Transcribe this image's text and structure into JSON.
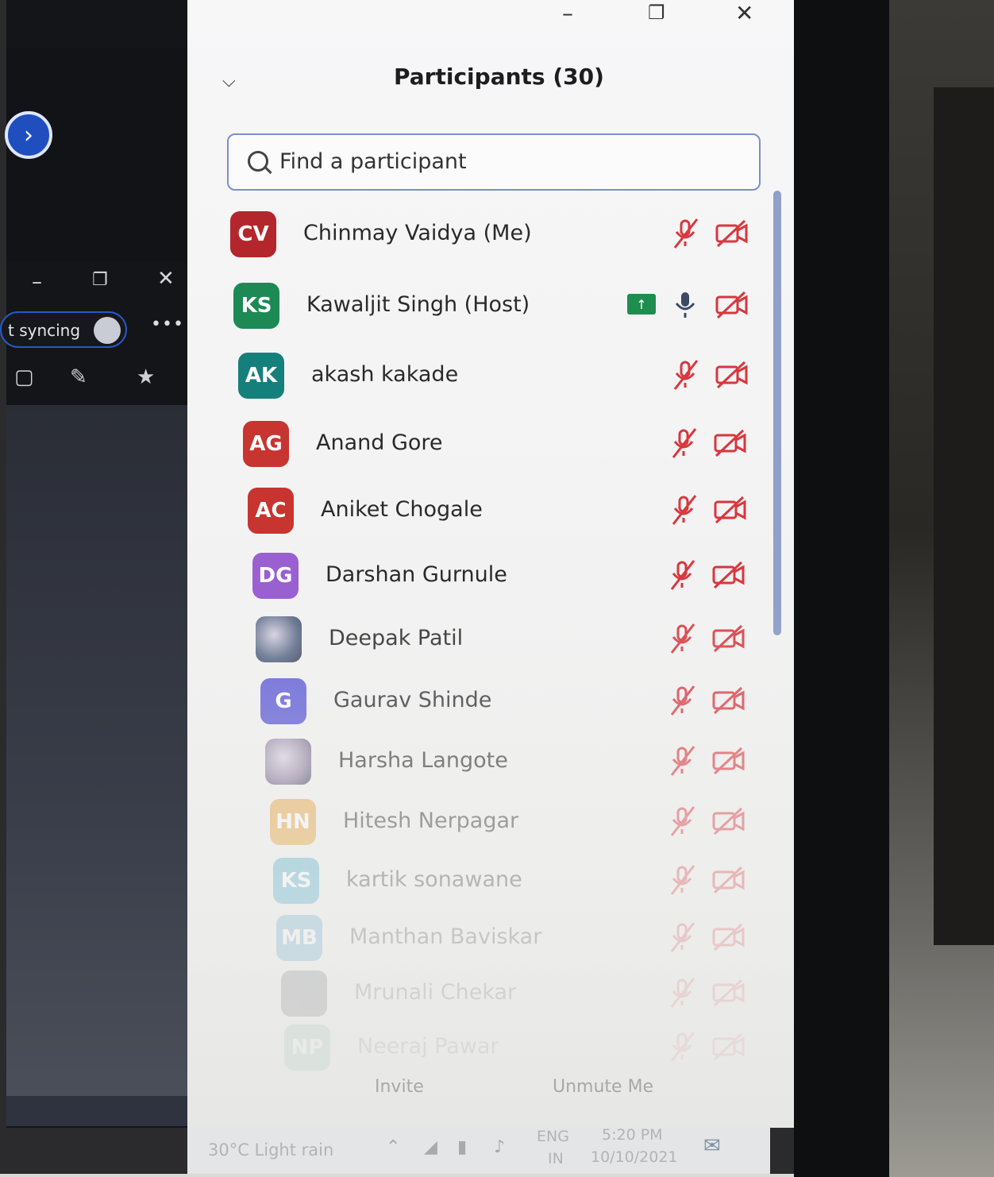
{
  "left_app": {
    "sync_text": "t syncing",
    "more": "•••"
  },
  "panel": {
    "title": "Participants (30)",
    "search_placeholder": "Find a participant",
    "participants": [
      {
        "initials": "CV",
        "name": "Chinmay Vaidya (Me)",
        "color": "#b3262c",
        "mic": "muted",
        "cam": "off"
      },
      {
        "initials": "KS",
        "name": "Kawaljit Singh (Host)",
        "color": "#1d8a55",
        "mic": "on",
        "cam": "off",
        "sharing": true
      },
      {
        "initials": "AK",
        "name": "akash kakade",
        "color": "#15807b",
        "mic": "muted",
        "cam": "off"
      },
      {
        "initials": "AG",
        "name": "Anand Gore",
        "color": "#c83430",
        "mic": "muted",
        "cam": "off"
      },
      {
        "initials": "AC",
        "name": "Aniket Chogale",
        "color": "#c83430",
        "mic": "muted",
        "cam": "off"
      },
      {
        "initials": "DG",
        "name": "Darshan Gurnule",
        "color": "#9a5fd0",
        "mic": "muted",
        "cam": "off"
      },
      {
        "initials": "",
        "name": "Deepak Patil",
        "color": "#5a6a88",
        "photo": true,
        "mic": "muted",
        "cam": "off"
      },
      {
        "initials": "G",
        "name": "Gaurav Shinde",
        "color": "#5a57d6",
        "mic": "muted",
        "cam": "off"
      },
      {
        "initials": "",
        "name": "Harsha Langote",
        "color": "#8e7fa0",
        "photo": true,
        "mic": "muted",
        "cam": "off"
      },
      {
        "initials": "HN",
        "name": "Hitesh Nerpagar",
        "color": "#e7a23a",
        "mic": "muted",
        "cam": "off"
      },
      {
        "initials": "KS",
        "name": "kartik sonawane",
        "color": "#3aa3c9",
        "mic": "muted",
        "cam": "off"
      },
      {
        "initials": "MB",
        "name": "Manthan Baviskar",
        "color": "#3a95c4",
        "mic": "muted",
        "cam": "off"
      },
      {
        "initials": "",
        "name": "Mrunali Chekar",
        "color": "#2a2d3a",
        "mic": "muted",
        "cam": "off"
      },
      {
        "initials": "NP",
        "name": "Neeraj Pawar",
        "color": "#2e9a6e",
        "mic": "muted",
        "cam": "off"
      }
    ],
    "invite_label": "Invite",
    "unmute_label": "Unmute Me"
  },
  "taskbar": {
    "weather": "30°C  Light rain",
    "lang_top": "ENG",
    "lang_bottom": "IN",
    "time": "5:20 PM",
    "date": "10/10/2021"
  },
  "colors": {
    "muted_red": "#d9363e",
    "accent_blue": "#2a57c8"
  }
}
